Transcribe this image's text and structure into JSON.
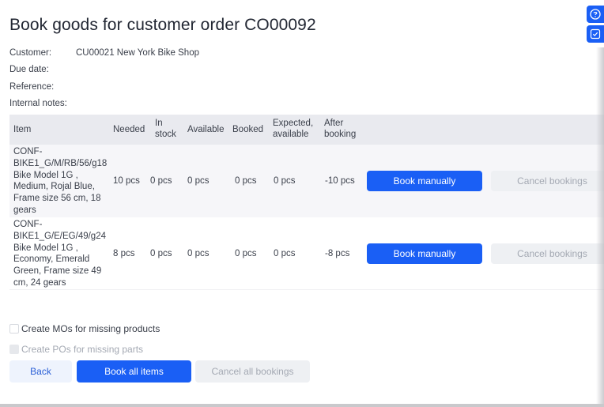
{
  "page": {
    "title": "Book goods for customer order CO00092"
  },
  "meta": [
    {
      "label": "Customer:",
      "value": "CU00021 New York Bike Shop"
    },
    {
      "label": "Due date:",
      "value": ""
    },
    {
      "label": "Reference:",
      "value": ""
    },
    {
      "label": "Internal notes:",
      "value": ""
    }
  ],
  "table": {
    "headers": {
      "item": "Item",
      "needed": "Needed",
      "in_stock": [
        "In",
        "stock"
      ],
      "available": "Available",
      "booked": "Booked",
      "expected": [
        "Expected,",
        "available"
      ],
      "after": [
        "After",
        "booking"
      ]
    },
    "rows": [
      {
        "item_lines": [
          "CONF-",
          "BIKE1_G/M/RB/56/g18",
          "Bike Model 1G ,",
          "Medium, Rojal Blue,",
          "Frame size 56 cm, 18",
          "gears"
        ],
        "needed": "10 pcs",
        "in_stock": "0 pcs",
        "available": "0 pcs",
        "booked": "0 pcs",
        "expected": "0 pcs",
        "after": "-10 pcs",
        "book_label": "Book manually",
        "cancel_label": "Cancel bookings"
      },
      {
        "item_lines": [
          "CONF-",
          "BIKE1_G/E/EG/49/g24",
          "Bike Model 1G ,",
          "Economy, Emerald",
          "Green, Frame size 49",
          "cm, 24 gears"
        ],
        "needed": "8 pcs",
        "in_stock": "0 pcs",
        "available": "0 pcs",
        "booked": "0 pcs",
        "expected": "0 pcs",
        "after": "-8 pcs",
        "book_label": "Book manually",
        "cancel_label": "Cancel bookings"
      }
    ]
  },
  "options": {
    "create_mos": {
      "label": "Create MOs for missing products",
      "checked": false,
      "disabled": false
    },
    "create_pos": {
      "label": "Create POs for missing parts",
      "checked": false,
      "disabled": true
    }
  },
  "footer": {
    "back": "Back",
    "book_all": "Book all items",
    "cancel_all": "Cancel all bookings"
  },
  "side": {
    "help_icon": "help-circle-icon",
    "check_icon": "checkbox-icon"
  },
  "colors": {
    "primary": "#1a5ff5",
    "header_bg": "#e9eaef",
    "disabled_bg": "#eef0f3"
  }
}
